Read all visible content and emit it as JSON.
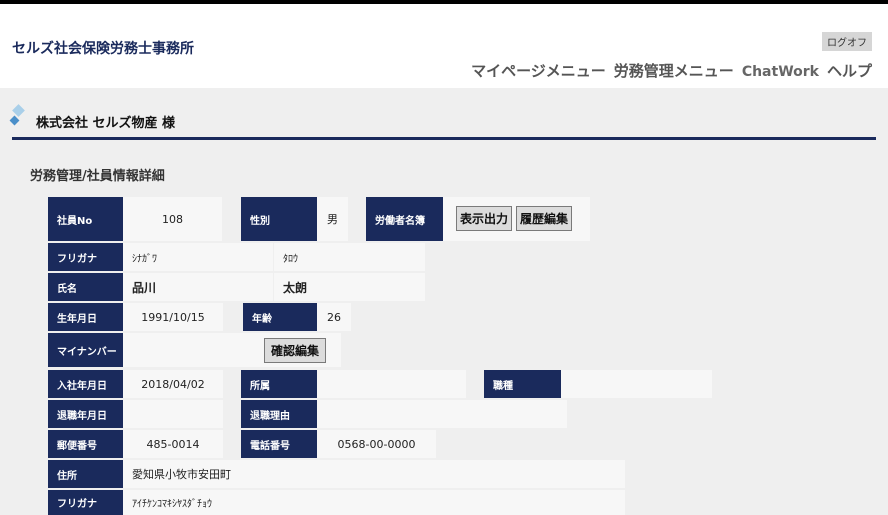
{
  "header": {
    "site_title": "セルズ社会保険労務士事務所",
    "logout_label": "ログオフ",
    "nav": {
      "mypage": "マイページメニュー",
      "labor": "労務管理メニュー",
      "chatwork": "ChatWork",
      "help": "ヘルプ"
    }
  },
  "company": {
    "name": "株式会社 セルズ物産 様"
  },
  "page": {
    "section_title": "労務管理/社員情報詳細"
  },
  "labels": {
    "employee_no": "社員No",
    "gender": "性別",
    "worker_roster": "労働者名簿",
    "furigana": "フリガナ",
    "name": "氏名",
    "birthdate": "生年月日",
    "age": "年齢",
    "my_number": "マイナンバー",
    "hire_date": "入社年月日",
    "department": "所属",
    "job_type": "職種",
    "retire_date": "退職年月日",
    "retire_reason": "退職理由",
    "postal_code": "郵便番号",
    "phone": "電話番号",
    "address": "住所",
    "address_furigana": "フリガナ"
  },
  "values": {
    "employee_no": "108",
    "gender": "男",
    "furigana_last": "ｼﾅｶﾞﾜ",
    "furigana_first": "ﾀﾛｳ",
    "name_last": "品川",
    "name_first": "太朗",
    "birthdate": "1991/10/15",
    "age": "26",
    "hire_date": "2018/04/02",
    "department": "",
    "job_type": "",
    "retire_date": "",
    "retire_reason": "",
    "postal_code": "485-0014",
    "phone": "0568-00-0000",
    "address": "愛知県小牧市安田町",
    "address_furigana": "ｱｲﾁｹﾝｺﾏｷｼﾔｽﾀﾞﾁｮｳ"
  },
  "buttons": {
    "print": "表示出力",
    "history_edit": "履歴編集",
    "confirm_edit": "確認編集"
  },
  "colors": {
    "navy": "#1a2a5c",
    "panel": "#efefef",
    "cell": "#f7f7f7"
  }
}
